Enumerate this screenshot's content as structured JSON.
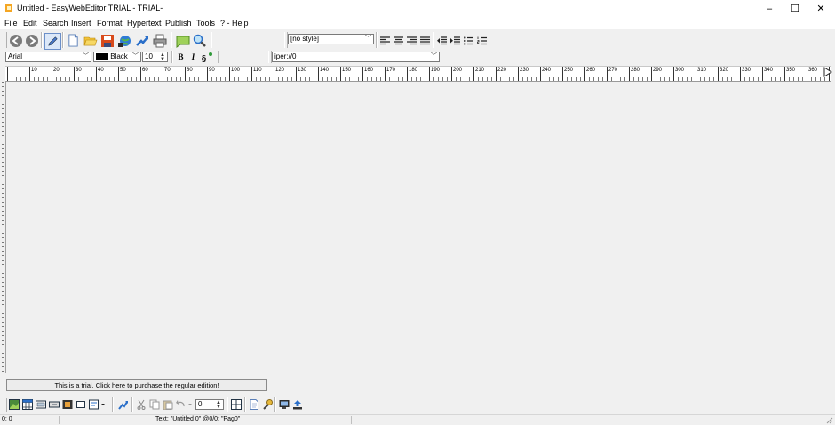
{
  "window": {
    "title": "Untitled - EasyWebEditor TRIAL - TRIAL-",
    "minimize": "–",
    "maximize": "☐",
    "close": "✕"
  },
  "menu": [
    "File",
    "Edit",
    "Search",
    "Insert",
    "Format",
    "Hypertext",
    "Publish",
    "Tools",
    "? - Help"
  ],
  "toolbar_main": {
    "icons": [
      "back-icon",
      "forward-icon",
      "edit-pen-icon",
      "new-document-icon",
      "open-folder-icon",
      "save-icon",
      "globe-icon",
      "publish-icon",
      "print-icon",
      "note-icon",
      "search-icon"
    ],
    "style_select": "[no style]",
    "align_icons": [
      "align-left-icon",
      "align-center-icon",
      "align-right-icon",
      "align-justify-icon",
      "outdent-icon",
      "indent-icon",
      "bullet-list-icon",
      "numbered-list-icon"
    ]
  },
  "toolbar_format": {
    "font": "Arial",
    "color_label": "Black",
    "color_hex": "#000000",
    "size": "10",
    "bold": "B",
    "italic": "I",
    "url": "iper://0"
  },
  "ruler": {
    "labels": [
      "10",
      "20",
      "30",
      "40",
      "50",
      "60",
      "70",
      "80",
      "90",
      "100",
      "110",
      "120",
      "130",
      "140",
      "150",
      "160",
      "170",
      "180",
      "190",
      "200",
      "210",
      "220",
      "230",
      "240",
      "250",
      "260",
      "270",
      "280",
      "290",
      "300",
      "310",
      "320",
      "330",
      "340",
      "350",
      "360"
    ]
  },
  "trial_notice": "This is a trial. Click here to purchase the regular edition!",
  "bottom_toolbar": {
    "spinner_value": "0"
  },
  "status": {
    "position": "0: 0",
    "text": "Text: \"Untitled 0\" @0/0; \"Pag0\""
  },
  "colors": {
    "titlebar": "#ffffff",
    "background": "#f0f0f0"
  }
}
